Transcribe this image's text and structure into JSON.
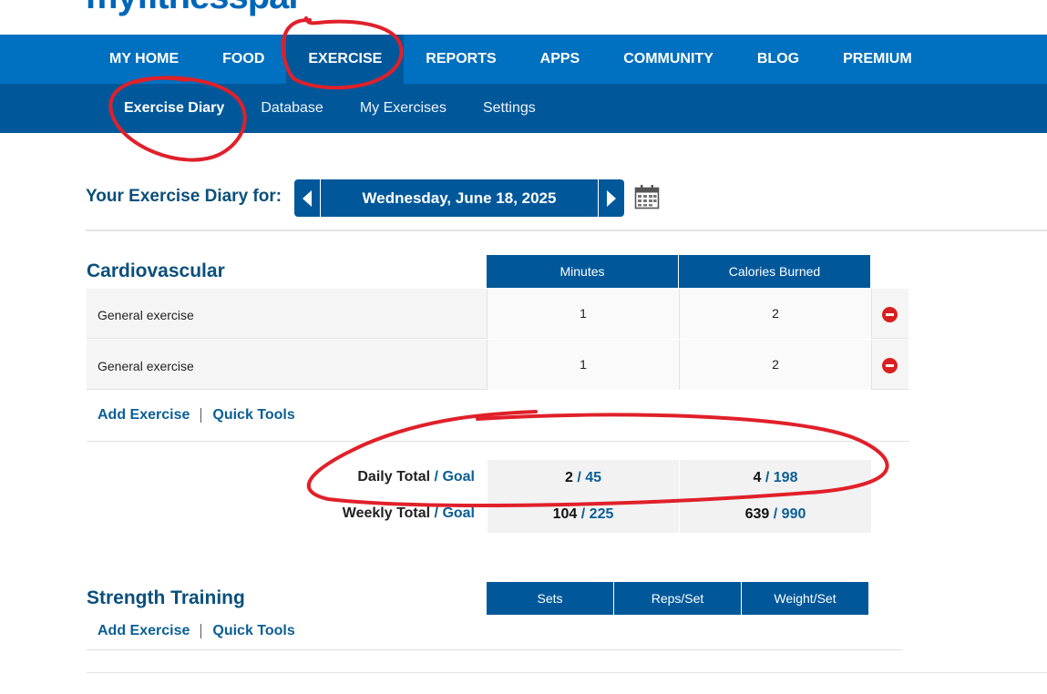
{
  "brand": {
    "logo": "myfitnesspal"
  },
  "main_nav": {
    "items": [
      {
        "label": "MY HOME"
      },
      {
        "label": "FOOD"
      },
      {
        "label": "EXERCISE"
      },
      {
        "label": "REPORTS"
      },
      {
        "label": "APPS"
      },
      {
        "label": "COMMUNITY"
      },
      {
        "label": "BLOG"
      },
      {
        "label": "PREMIUM"
      }
    ]
  },
  "sub_nav": {
    "items": [
      {
        "label": "Exercise Diary"
      },
      {
        "label": "Database"
      },
      {
        "label": "My Exercises"
      },
      {
        "label": "Settings"
      }
    ]
  },
  "diary": {
    "label": "Your Exercise Diary for:",
    "date": "Wednesday, June 18, 2025"
  },
  "cardio": {
    "title": "Cardiovascular",
    "columns": [
      "Minutes",
      "Calories Burned"
    ],
    "rows": [
      {
        "name": "General exercise",
        "minutes": "1",
        "calories": "2"
      },
      {
        "name": "General exercise",
        "minutes": "1",
        "calories": "2"
      }
    ],
    "links": {
      "add": "Add Exercise",
      "quick": "Quick Tools"
    },
    "daily": {
      "label": "Daily Total",
      "goal_word": "Goal",
      "minutes": "2",
      "minutes_goal": "45",
      "calories": "4",
      "calories_goal": "198"
    },
    "weekly": {
      "label": "Weekly Total",
      "goal_word": "Goal",
      "minutes": "104",
      "minutes_goal": "225",
      "calories": "639",
      "calories_goal": "990"
    }
  },
  "strength": {
    "title": "Strength Training",
    "columns": [
      "Sets",
      "Reps/Set",
      "Weight/Set"
    ],
    "links": {
      "add": "Add Exercise",
      "quick": "Quick Tools"
    }
  },
  "colors": {
    "nav": "#0070c0",
    "subnav": "#00589b",
    "heading": "#0b4f7c",
    "link": "#0b5e96",
    "delete": "#d91f1f",
    "annotation": "#e0202a"
  }
}
